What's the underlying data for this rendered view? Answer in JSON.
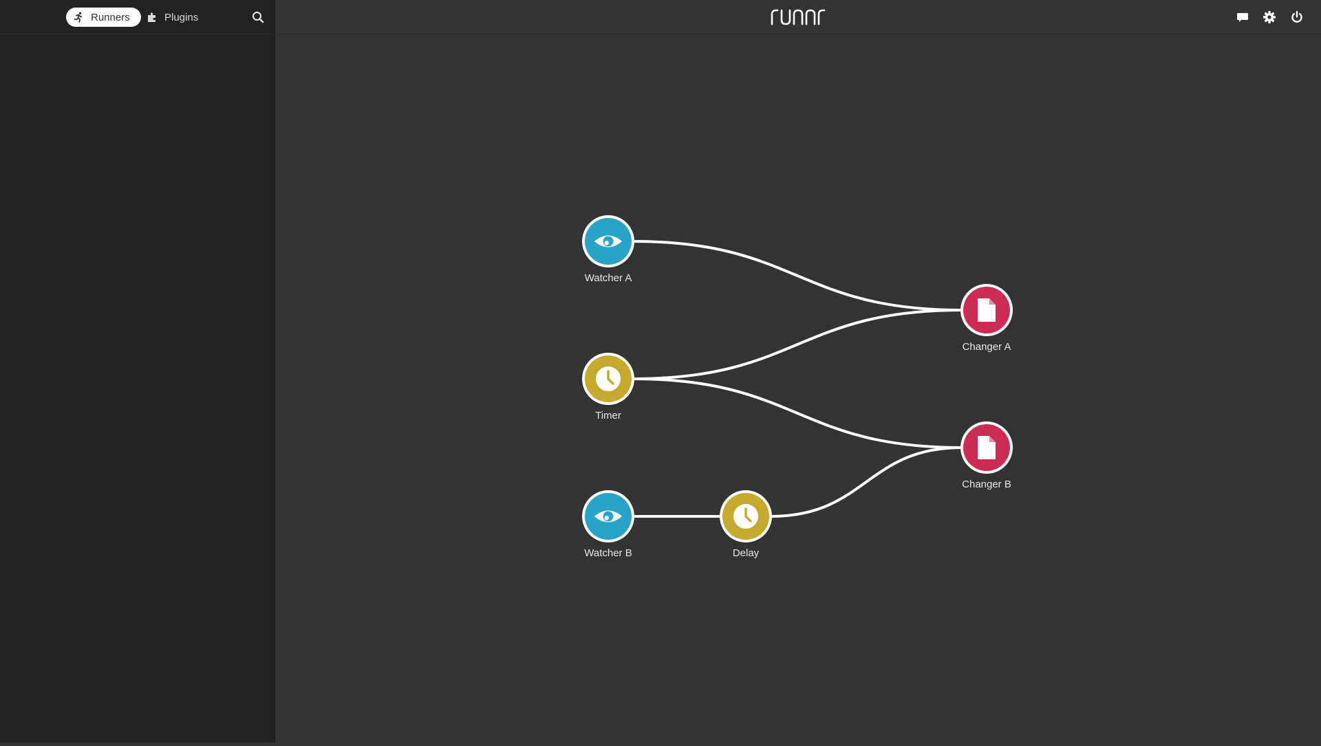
{
  "sidebar": {
    "tabs": [
      {
        "label": "Runners",
        "icon": "running-person-icon",
        "active": true
      },
      {
        "label": "Plugins",
        "icon": "puzzle-piece-icon",
        "active": false
      }
    ],
    "search_icon": "search-icon"
  },
  "header": {
    "logo_text": "runnr",
    "icons": [
      "chat-bubble-icon",
      "gear-icon",
      "power-icon"
    ]
  },
  "graph": {
    "nodes": [
      {
        "id": "watcher-a",
        "label": "Watcher A",
        "kind": "watcher",
        "icon": "eye-icon",
        "color": "#2aa3c9"
      },
      {
        "id": "timer",
        "label": "Timer",
        "kind": "timer",
        "icon": "clock-icon",
        "color": "#c6aa2e"
      },
      {
        "id": "watcher-b",
        "label": "Watcher B",
        "kind": "watcher",
        "icon": "eye-icon",
        "color": "#2aa3c9"
      },
      {
        "id": "delay",
        "label": "Delay",
        "kind": "timer",
        "icon": "clock-icon",
        "color": "#c6aa2e"
      },
      {
        "id": "changer-a",
        "label": "Changer A",
        "kind": "changer",
        "icon": "file-icon",
        "color": "#cc2b54"
      },
      {
        "id": "changer-b",
        "label": "Changer B",
        "kind": "changer",
        "icon": "file-icon",
        "color": "#cc2b54"
      }
    ],
    "edges": [
      {
        "from": "watcher-a",
        "to": "changer-a"
      },
      {
        "from": "timer",
        "to": "changer-a"
      },
      {
        "from": "timer",
        "to": "changer-b"
      },
      {
        "from": "watcher-b",
        "to": "delay"
      },
      {
        "from": "delay",
        "to": "changer-b"
      }
    ]
  },
  "colors": {
    "sidebar_bg": "#222222",
    "canvas_bg": "#333333",
    "watcher": "#2aa3c9",
    "timer": "#c6aa2e",
    "changer": "#cc2b54",
    "edge": "#ffffff"
  }
}
